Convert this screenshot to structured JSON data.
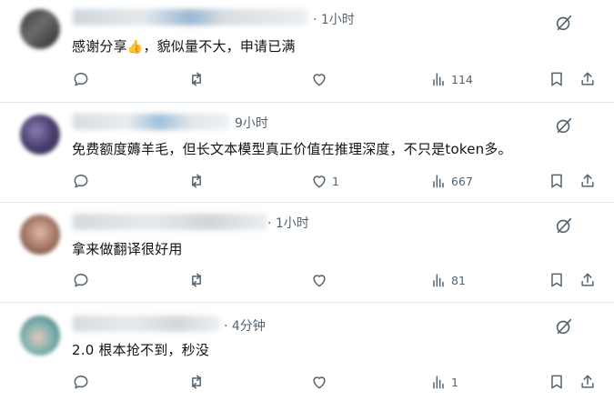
{
  "replies": [
    {
      "time": "· 1小时",
      "text_before": "感谢分享",
      "emoji": "👍",
      "text_after": "，貌似量不大，申请已满",
      "reply_count": "",
      "retweet_count": "",
      "like_count": "",
      "views": "114"
    },
    {
      "time": "9小时",
      "text_before": "免费额度薅羊毛，但长文本模型真正价值在推理深度，不只是token多。",
      "emoji": "",
      "text_after": "",
      "reply_count": "",
      "retweet_count": "",
      "like_count": "1",
      "views": "667"
    },
    {
      "time": "· 1小时",
      "text_before": "拿来做翻译很好用",
      "emoji": "",
      "text_after": "",
      "reply_count": "",
      "retweet_count": "",
      "like_count": "",
      "views": "81"
    },
    {
      "time": "· 4分钟",
      "text_before": "2.0 根本抢不到，秒没",
      "emoji": "",
      "text_after": "",
      "reply_count": "",
      "retweet_count": "",
      "like_count": "",
      "views": "1"
    }
  ],
  "colors": {
    "text": "#0f1419",
    "muted": "#536471",
    "divider": "#e1e6ea"
  },
  "icons": [
    "grok-icon",
    "reply-icon",
    "retweet-icon",
    "like-icon",
    "views-icon",
    "bookmark-icon",
    "share-icon"
  ]
}
